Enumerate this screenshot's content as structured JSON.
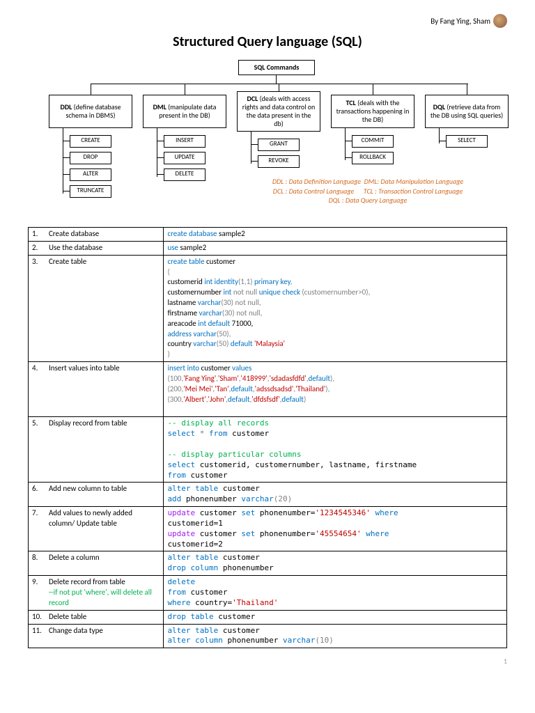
{
  "byline": "By Fang Ying, Sham",
  "title": "Structured Query language (SQL)",
  "diagram": {
    "root": "SQL Commands",
    "cats": [
      {
        "abbr": "DDL",
        "desc": "(define database schema in DBMS)",
        "cmds": [
          "CREATE",
          "DROP",
          "ALTER",
          "TRUNCATE"
        ]
      },
      {
        "abbr": "DML",
        "desc": "(manipulate data present in the DB)",
        "cmds": [
          "INSERT",
          "UPDATE",
          "DELETE"
        ]
      },
      {
        "abbr": "DCL",
        "desc": "(deals with access rights and data control on the data present in the db)",
        "cmds": [
          "GRANT",
          "REVOKE"
        ]
      },
      {
        "abbr": "TCL",
        "desc": "(deals with the transactions happening in the DB)",
        "cmds": [
          "COMMIT",
          "ROLLBACK"
        ]
      },
      {
        "abbr": "DQL",
        "desc": "(retrieve data from the DB using SQL queries)",
        "cmds": [
          "SELECT"
        ]
      }
    ],
    "legend": {
      "l1a": "DDL : Data Definition Language",
      "l1b": "DML: Data Manipulation Language",
      "l2a": "DCL : Data Control Language",
      "l2b": "TCL : Transaction Control Language",
      "l3": "DQL : Data Query Language"
    }
  },
  "rows": {
    "r1": {
      "n": "1.",
      "d": "Create database"
    },
    "r2": {
      "n": "2.",
      "d": "Use the database"
    },
    "r3": {
      "n": "3.",
      "d": "Create table"
    },
    "r4": {
      "n": "4.",
      "d": "Insert values into table"
    },
    "r5": {
      "n": "5.",
      "d": "Display record from table"
    },
    "r6": {
      "n": "6.",
      "d": "Add new column to table"
    },
    "r7": {
      "n": "7.",
      "d": "Add values to newly added column/ Update table"
    },
    "r8": {
      "n": "8.",
      "d": "Delete a column"
    },
    "r9": {
      "n": "9.",
      "d": "Delete record from table",
      "note": "--if not put 'where', will delete all record"
    },
    "r10": {
      "n": "10.",
      "d": "Delete table"
    },
    "r11": {
      "n": "11.",
      "d": "Change data type"
    }
  },
  "code": {
    "r1": {
      "k1": "create database",
      "t1": " sample2"
    },
    "r2": {
      "k1": "use",
      "t1": " sample2"
    },
    "r3": {
      "k1": "create table",
      "t1": " customer",
      "op": "(",
      "c1a": "customerid ",
      "c1b": "int identity",
      "c1c": "(1,1)",
      "c1d": " primary key",
      "c1e": ",",
      "c2a": "customernumber ",
      "c2b": "int",
      "c2c": " not null",
      "c2d": " unique check ",
      "c2e": "(customernumber>0),",
      "c3a": "lastname ",
      "c3b": "varchar",
      "c3c": "(30)",
      "c3d": " not null",
      "c3e": ",",
      "c4a": "firstname ",
      "c4b": "varchar",
      "c4c": "(30)",
      "c4d": " not null",
      "c4e": ",",
      "c5a": "areacode ",
      "c5b": "int default",
      "c5c": " 71000,",
      "c6a": "address varchar",
      "c6b": "(50),",
      "c7a": "country ",
      "c7b": "varchar",
      "c7c": "(50)",
      "c7d": " default ",
      "c7e": "'Malaysia'",
      "cp": ")"
    },
    "r4": {
      "k1": "insert into",
      "t1": " customer ",
      "k2": "values",
      "l1a": "(100,",
      "l1b": "'Fang Ying'",
      "l1c": ",",
      "l1d": "'Sham'",
      "l1e": ",",
      "l1f": "'418999'",
      "l1g": ",",
      "l1h": "'sdadasfdfd'",
      "l1i": ",",
      "l1j": "default",
      "l1k": "),",
      "l2a": "(200,",
      "l2b": "'Mei Mei'",
      "l2c": ",",
      "l2d": "'Tan'",
      "l2e": ",",
      "l2f": "default",
      "l2g": ",",
      "l2h": "'adssdsadsd'",
      "l2i": ",",
      "l2j": "'Thailand'",
      "l2k": "),",
      "l3a": "(300,",
      "l3b": "'Albert'",
      "l3c": ",",
      "l3d": "'John'",
      "l3e": ",",
      "l3f": "default",
      "l3g": ",",
      "l3h": "'dfdsfsdf'",
      "l3i": ",",
      "l3j": "default",
      "l3k": ")"
    },
    "r5": {
      "c1": "-- display all records",
      "k1": "select ",
      "op": "*",
      "k2": " from",
      "t1": " customer",
      "c2": "-- display particular columns",
      "k3": "select",
      "t2": " customerid, customernumber, lastname, firstname",
      "k4": "from",
      "t3": " customer"
    },
    "r6": {
      "k1": "alter table",
      "t1": " customer",
      "k2": "add",
      "t2": " phonenumber ",
      "k3": "varchar",
      "t3": "(20)"
    },
    "r7": {
      "k1": "update",
      "t1": " customer ",
      "k2": "set",
      "t2": " phonenumber=",
      "s1": "'1234545346'",
      "k3": " where",
      "t3": "customerid=1",
      "k4": "update",
      "t4": " customer ",
      "k5": "set",
      "t5": " phonenumber=",
      "s2": "'45554654'",
      "k6": " where",
      "t6": "customerid=2"
    },
    "r8": {
      "k1": "alter table",
      "t1": " customer",
      "k2": "drop column",
      "t2": " phonenumber"
    },
    "r9": {
      "k1": "delete",
      "k2": "from",
      "t1": " customer",
      "k3": "where",
      "t2": " country=",
      "s1": "'Thailand'"
    },
    "r10": {
      "k1": "drop table",
      "t1": " customer"
    },
    "r11": {
      "k1": "alter table",
      "t1": " customer",
      "k2": "alter column",
      "t2": " phonenumber ",
      "k3": "varchar",
      "t3": "(10)"
    }
  },
  "page": "1"
}
